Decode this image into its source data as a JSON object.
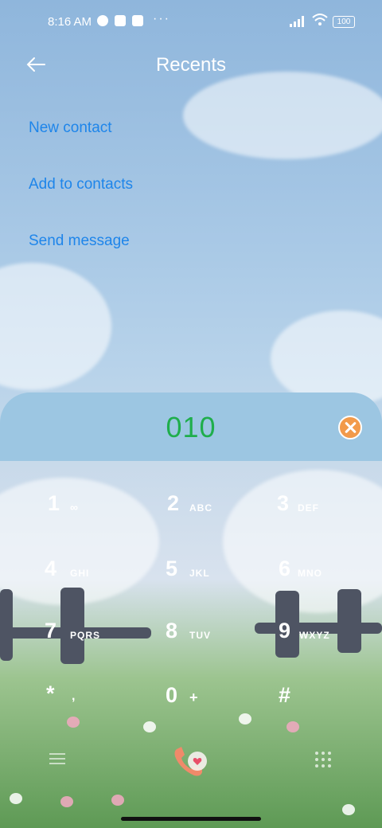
{
  "status_bar": {
    "time": "8:16 AM",
    "dots": "···",
    "battery": "100"
  },
  "header": {
    "title": "Recents"
  },
  "actions": {
    "new_contact": "New contact",
    "add_to_contacts": "Add to contacts",
    "send_message": "Send message"
  },
  "dialer": {
    "number": "010"
  },
  "keys": [
    {
      "digit": "1",
      "letters": "∞"
    },
    {
      "digit": "2",
      "letters": "ABC"
    },
    {
      "digit": "3",
      "letters": "DEF"
    },
    {
      "digit": "4",
      "letters": "GHI"
    },
    {
      "digit": "5",
      "letters": "JKL"
    },
    {
      "digit": "6",
      "letters": "MNO"
    },
    {
      "digit": "7",
      "letters": "PQRS"
    },
    {
      "digit": "8",
      "letters": "TUV"
    },
    {
      "digit": "9",
      "letters": "WXYZ"
    },
    {
      "digit": "*",
      "letters": ","
    },
    {
      "digit": "0",
      "letters": "+"
    },
    {
      "digit": "#",
      "letters": ""
    }
  ],
  "colors": {
    "number": "#1fae4c",
    "link": "#1e85ea",
    "panel": "#9cc6e2",
    "clear": "#f29a4a"
  }
}
